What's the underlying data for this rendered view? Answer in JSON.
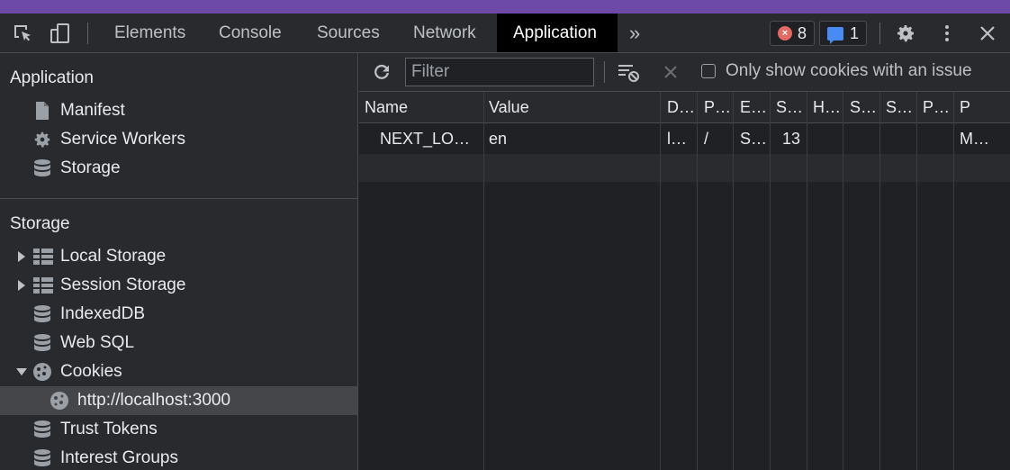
{
  "toolbar": {
    "tabs": [
      "Elements",
      "Console",
      "Sources",
      "Network",
      "Application"
    ],
    "active_tab": "Application",
    "more_tabs_glyph": "»",
    "errors_count": "8",
    "messages_count": "1",
    "error_glyph": "×"
  },
  "sidebar": {
    "application_heading": "Application",
    "application_items": [
      {
        "label": "Manifest",
        "icon": "file-icon"
      },
      {
        "label": "Service Workers",
        "icon": "gear-icon"
      },
      {
        "label": "Storage",
        "icon": "database-icon"
      }
    ],
    "storage_heading": "Storage",
    "storage_items": [
      {
        "label": "Local Storage",
        "icon": "table-icon",
        "expandable": "collapsed"
      },
      {
        "label": "Session Storage",
        "icon": "table-icon",
        "expandable": "collapsed"
      },
      {
        "label": "IndexedDB",
        "icon": "database-icon"
      },
      {
        "label": "Web SQL",
        "icon": "database-icon"
      },
      {
        "label": "Cookies",
        "icon": "cookie-icon",
        "expandable": "expanded"
      },
      {
        "label": "http://localhost:3000",
        "icon": "cookie-icon",
        "selected": true
      },
      {
        "label": "Trust Tokens",
        "icon": "database-icon"
      },
      {
        "label": "Interest Groups",
        "icon": "database-icon"
      }
    ]
  },
  "cookies": {
    "filter_placeholder": "Filter",
    "filter_value": "",
    "only_issues_label": "Only show cookies with an issue",
    "only_issues_checked": false,
    "columns": [
      "Name",
      "Value",
      "D…",
      "P…",
      "E…",
      "S…",
      "H…",
      "S…",
      "S…",
      "P…",
      "P"
    ],
    "rows": [
      [
        "NEXT_LO…",
        "en",
        "l…",
        "/",
        "S…",
        "13",
        "",
        "",
        "",
        "",
        "M…"
      ]
    ]
  },
  "colors": {
    "accent_strip": "#6d4aa7",
    "background": "#202124",
    "panel": "#292a2d",
    "selected_row": "#454649"
  }
}
